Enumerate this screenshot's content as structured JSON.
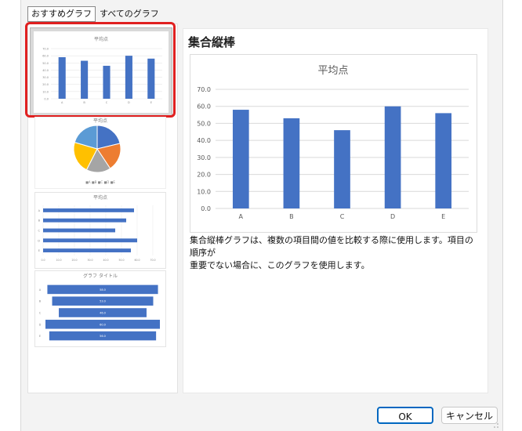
{
  "tabs": [
    {
      "label": "おすすめグラフ",
      "active": true
    },
    {
      "label": "すべてのグラフ",
      "active": false
    }
  ],
  "thumbnails": {
    "clustered_column": {
      "title": "平均点",
      "yticks": [
        "70.0",
        "60.0",
        "50.0",
        "40.0",
        "30.0",
        "20.0",
        "10.0",
        "0.0"
      ],
      "categories": [
        "A",
        "B",
        "C",
        "D",
        "E"
      ],
      "values": [
        58,
        53,
        46,
        60,
        56
      ]
    },
    "pie": {
      "title": "平均点",
      "legend": "■A ■B ■C ■D ■E",
      "categories": [
        "A",
        "B",
        "C",
        "D",
        "E"
      ],
      "values": [
        58,
        53,
        46,
        60,
        56
      ],
      "colors": [
        "#4472c4",
        "#ed7d31",
        "#a5a5a5",
        "#ffc000",
        "#5b9bd5"
      ]
    },
    "bar": {
      "title": "平均点",
      "categories": [
        "A",
        "B",
        "C",
        "D",
        "E"
      ],
      "values": [
        58,
        53,
        46,
        60,
        56
      ],
      "xticks": [
        "0.0",
        "10.0",
        "20.0",
        "30.0",
        "40.0",
        "50.0",
        "60.0",
        "70.0"
      ]
    },
    "funnel": {
      "title": "グラフ タイトル",
      "categories": [
        "A",
        "B",
        "C",
        "D",
        "E"
      ],
      "values": [
        58,
        53,
        46,
        60,
        56
      ],
      "labels": [
        "58.0",
        "53.0",
        "46.0",
        "60.0",
        "56.0"
      ]
    }
  },
  "preview": {
    "heading": "集合縦棒",
    "description_line1": "集合縦棒グラフは、複数の項目間の値を比較する際に使用します。項目の順序が",
    "description_line2": "重要でない場合に、このグラフを使用します。"
  },
  "chart_data": {
    "type": "bar",
    "title": "平均点",
    "categories": [
      "A",
      "B",
      "C",
      "D",
      "E"
    ],
    "values": [
      58,
      53,
      46,
      60,
      56
    ],
    "ylim": [
      0,
      70
    ],
    "yticks": [
      "0.0",
      "10.0",
      "20.0",
      "30.0",
      "40.0",
      "50.0",
      "60.0",
      "70.0"
    ],
    "grid": true,
    "bar_color": "#4472c4"
  },
  "buttons": {
    "ok": "OK",
    "cancel": "キャンセル"
  },
  "colors": {
    "accent": "#0067c0",
    "selection_highlight": "#e02020",
    "bar": "#4472c4"
  }
}
